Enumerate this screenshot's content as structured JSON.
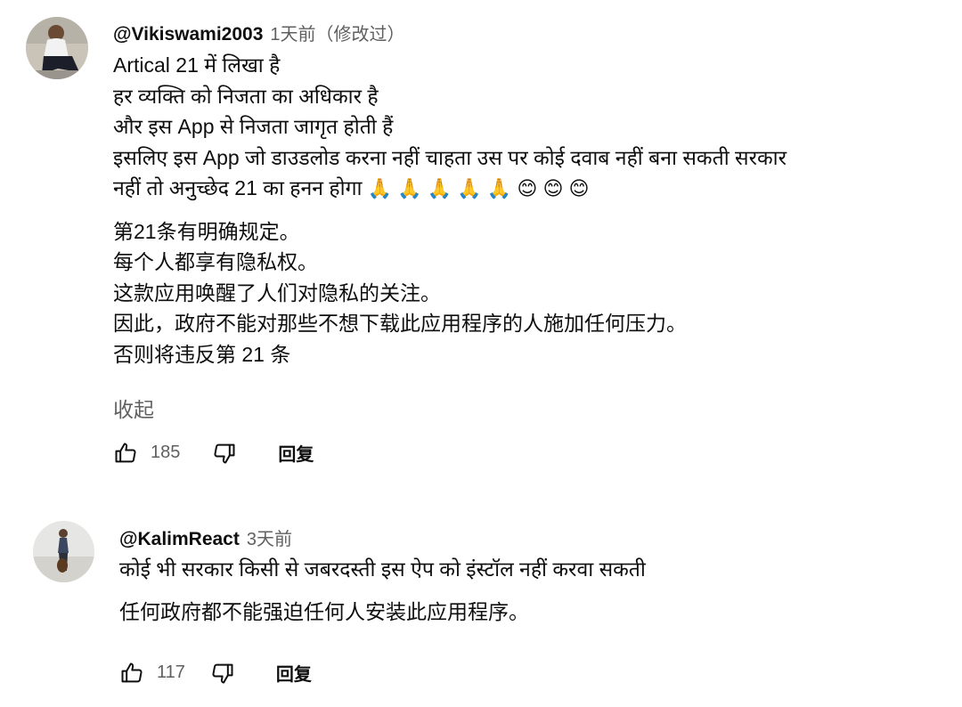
{
  "comments": [
    {
      "author": "@Vikiswami2003",
      "time": "1天前（修改过）",
      "lines_hi": [
        "Artical 21 में लिखा है",
        "हर व्यक्ति को निजता का अधिकार है",
        "और इस App से निजता जागृत होती हैं",
        "इसलिए इस App जो डाउडलोड करना नहीं चाहता उस पर कोई दवाब नहीं बना सकती सरकार",
        "नहीं तो अनुच्छेद 21 का हनन होगा"
      ],
      "emojis": "🙏 🙏 🙏 🙏 🙏  😊 😊 😊",
      "lines_zh": [
        "第21条有明确规定。",
        "每个人都享有隐私权。",
        "这款应用唤醒了人们对隐私的关注。",
        "因此，政府不能对那些不想下载此应用程序的人施加任何压力。",
        "否则将违反第 21 条"
      ],
      "collapse_label": "收起",
      "likes": "185",
      "reply_label": "回复"
    },
    {
      "author": "@KalimReact",
      "time": "3天前",
      "line_hi": "कोई भी सरकार किसी से जबरदस्ती इस ऐप को इंस्टॉल नहीं करवा सकती",
      "line_zh": "任何政府都不能强迫任何人安装此应用程序。",
      "likes": "117",
      "reply_label": "回复"
    }
  ],
  "icons": [
    "thumb-up-icon",
    "thumb-down-icon"
  ]
}
